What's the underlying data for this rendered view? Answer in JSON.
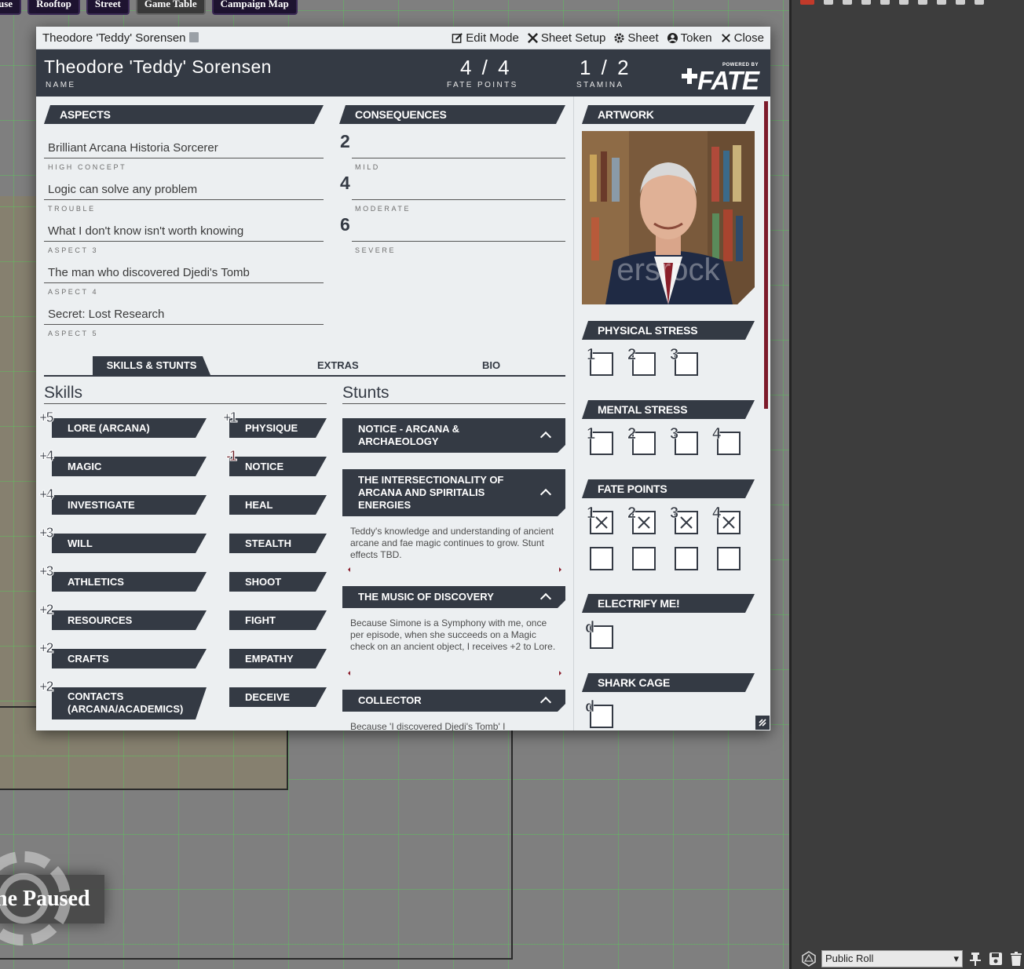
{
  "page_tabs": [
    "use",
    "Rooftop",
    "Street",
    "Game Table",
    "Campaign Map"
  ],
  "paused_label": "ne Paused",
  "roll_bar": {
    "selected": "Public Roll"
  },
  "window": {
    "title": "Theodore 'Teddy' Sorensen",
    "buttons": {
      "edit_mode": "Edit Mode",
      "sheet_setup": "Sheet Setup",
      "sheet": "Sheet",
      "token": "Token",
      "close": "Close"
    }
  },
  "header": {
    "name": "Theodore 'Teddy' Sorensen",
    "name_label": "NAME",
    "fate_points": "4 / 4",
    "fate_points_label": "FATE POINTS",
    "stamina": "1 / 2",
    "stamina_label": "STAMINA",
    "logo_powered": "POWERED BY",
    "logo_text": "FATE"
  },
  "aspects": {
    "title": "ASPECTS",
    "items": [
      {
        "value": "Brilliant Arcana Historia Sorcerer",
        "label": "HIGH CONCEPT"
      },
      {
        "value": "Logic can solve any problem",
        "label": "TROUBLE"
      },
      {
        "value": "What I don't know isn't worth knowing",
        "label": "ASPECT 3"
      },
      {
        "value": "The man who discovered Djedi's Tomb",
        "label": "ASPECT 4"
      },
      {
        "value": "Secret: Lost Research",
        "label": "ASPECT 5"
      }
    ]
  },
  "consequences": {
    "title": "CONSEQUENCES",
    "items": [
      {
        "num": "2",
        "value": "",
        "label": "MILD"
      },
      {
        "num": "4",
        "value": "",
        "label": "MODERATE"
      },
      {
        "num": "6",
        "value": "",
        "label": "SEVERE"
      }
    ]
  },
  "tabs": [
    "SKILLS & STUNTS",
    "EXTRAS",
    "BIO"
  ],
  "skills": {
    "title": "Skills",
    "left": [
      {
        "rank": "+5",
        "name": "LORE (ARCANA)"
      },
      {
        "rank": "+4",
        "name": "MAGIC"
      },
      {
        "rank": "+4",
        "name": "INVESTIGATE"
      },
      {
        "rank": "+3",
        "name": "WILL"
      },
      {
        "rank": "+3",
        "name": "ATHLETICS"
      },
      {
        "rank": "+2",
        "name": "RESOURCES"
      },
      {
        "rank": "+2",
        "name": "CRAFTS"
      },
      {
        "rank": "+2",
        "name": "CONTACTS (ARCANA/ACADEMICS)"
      }
    ],
    "right": [
      {
        "rank": "+1",
        "name": "PHYSIQUE"
      },
      {
        "rank": "-1",
        "name": "NOTICE"
      },
      {
        "rank": "",
        "name": "HEAL"
      },
      {
        "rank": "",
        "name": "STEALTH"
      },
      {
        "rank": "",
        "name": "SHOOT"
      },
      {
        "rank": "",
        "name": "FIGHT"
      },
      {
        "rank": "",
        "name": "EMPATHY"
      },
      {
        "rank": "",
        "name": "DECEIVE"
      }
    ]
  },
  "stunts": {
    "title": "Stunts",
    "items": [
      {
        "name": "NOTICE - ARCANA & ARCHAEOLOGY",
        "text": ""
      },
      {
        "name": "THE INTERSECTIONALITY OF ARCANA AND SPIRITALIS ENERGIES",
        "text": "Teddy's knowledge and understanding of ancient arcane and fae magic continues to grow. Stunt effects TBD."
      },
      {
        "name": "THE MUSIC OF DISCOVERY",
        "text": "Because Simone is a Symphony with me, once per episode, when she succeeds on a Magic check on an ancient object, I receives +2 to Lore."
      },
      {
        "name": "COLLECTOR",
        "text": "Because 'I discovered Djedi's Tomb' I"
      }
    ]
  },
  "artwork": {
    "title": "ARTWORK",
    "watermark": "ersrock"
  },
  "physical_stress": {
    "title": "PHYSICAL STRESS",
    "boxes": [
      "1",
      "2",
      "3"
    ],
    "checked": [
      false,
      false,
      false
    ]
  },
  "mental_stress": {
    "title": "MENTAL STRESS",
    "boxes": [
      "1",
      "2",
      "3",
      "4"
    ],
    "checked": [
      false,
      false,
      false,
      false
    ]
  },
  "fate_point_track": {
    "title": "FATE POINTS",
    "boxes": [
      "1",
      "2",
      "3",
      "4"
    ],
    "checked": [
      true,
      true,
      true,
      true
    ],
    "extra_boxes": 4
  },
  "electrify": {
    "title": "ELECTRIFY ME!",
    "box_label": "d"
  },
  "shark_cage": {
    "title": "SHARK CAGE",
    "box_label": "d"
  },
  "colors": {
    "sheet_dark": "#343a44",
    "accent": "#7c1a2a",
    "panel": "#eceff1"
  }
}
